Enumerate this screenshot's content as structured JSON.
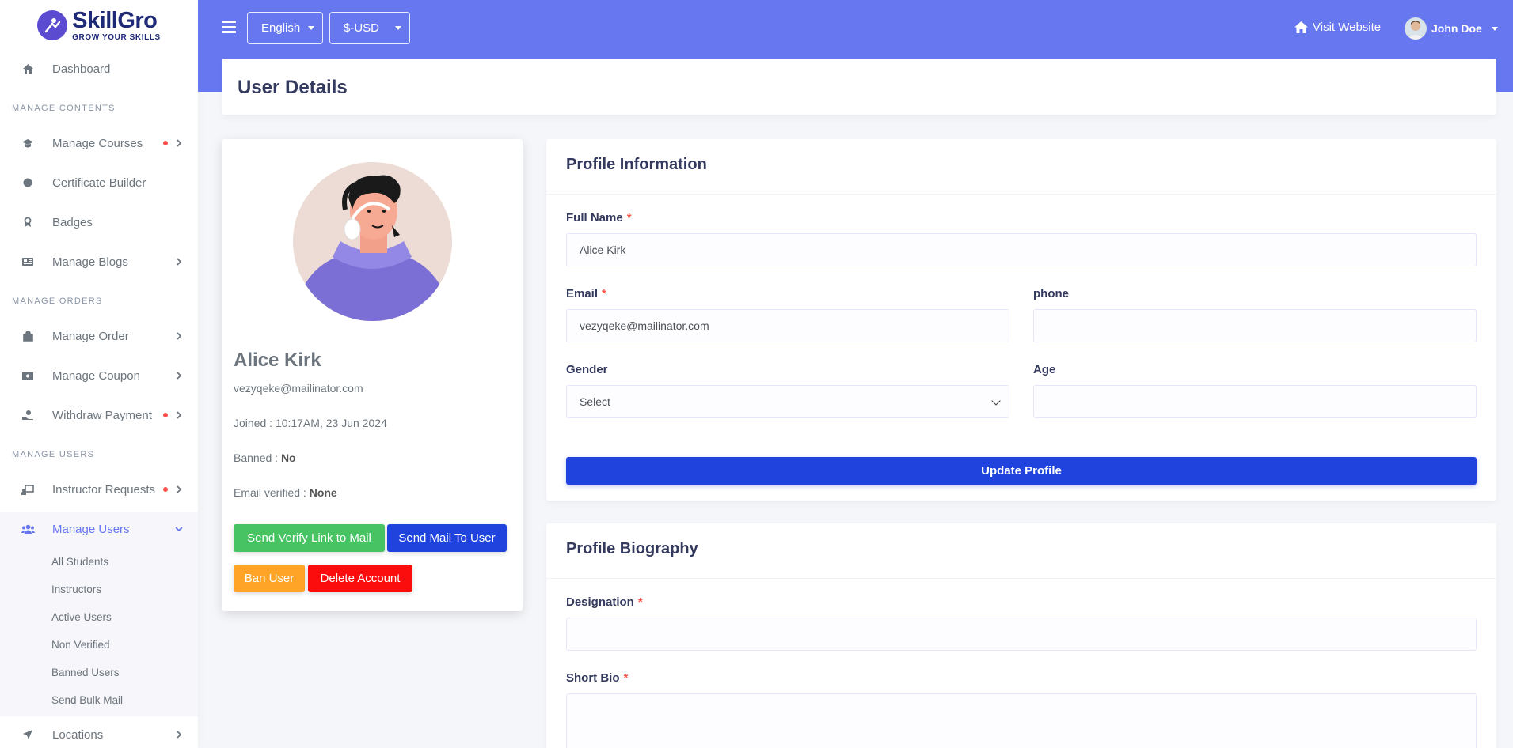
{
  "brand": {
    "name": "SkillGro",
    "tagline": "GROW YOUR SKILLS"
  },
  "sidebar": {
    "dashboard": "Dashboard",
    "headers": {
      "contents": "MANAGE CONTENTS",
      "orders": "MANAGE ORDERS",
      "users": "MANAGE USERS"
    },
    "items": {
      "courses": "Manage Courses",
      "certificate": "Certificate Builder",
      "badges": "Badges",
      "blogs": "Manage Blogs",
      "order": "Manage Order",
      "coupon": "Manage Coupon",
      "withdraw": "Withdraw Payment",
      "instructor_requests": "Instructor Requests",
      "manage_users": "Manage Users",
      "locations": "Locations"
    },
    "sub_items": [
      "All Students",
      "Instructors",
      "Active Users",
      "Non Verified",
      "Banned Users",
      "Send Bulk Mail"
    ]
  },
  "topbar": {
    "language": "English",
    "currency": "$-USD",
    "visit_website": "Visit Website",
    "user_name": "John Doe"
  },
  "page": {
    "title": "User Details"
  },
  "profile": {
    "name": "Alice Kirk",
    "email": "vezyqeke@mailinator.com",
    "joined_label": "Joined : ",
    "joined_value": "10:17AM, 23 Jun 2024",
    "banned_label": "Banned : ",
    "banned_value": "No",
    "verified_label": "Email verified : ",
    "verified_value": "None",
    "buttons": {
      "send_verify": "Send Verify Link to Mail",
      "send_mail": "Send Mail To User",
      "ban": "Ban User",
      "delete": "Delete Account"
    }
  },
  "profile_info": {
    "title": "Profile Information",
    "full_name_label": "Full Name",
    "full_name_value": "Alice Kirk",
    "email_label": "Email",
    "email_value": "vezyqeke@mailinator.com",
    "phone_label": "phone",
    "phone_value": "",
    "gender_label": "Gender",
    "gender_value": "Select",
    "age_label": "Age",
    "age_value": "",
    "update_button": "Update Profile",
    "required_mark": "*"
  },
  "bio": {
    "title": "Profile Biography",
    "designation_label": "Designation",
    "short_bio_label": "Short Bio",
    "required_mark": "*"
  },
  "colors": {
    "primary": "#6777ef",
    "success": "#47c363",
    "blue": "#2043de",
    "warning": "#ffa426",
    "danger": "#fc0d0d",
    "badge_dot": "#fc544b"
  }
}
